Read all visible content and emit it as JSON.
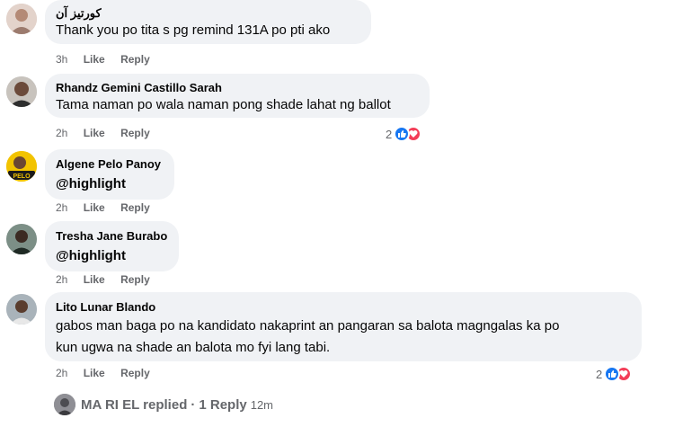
{
  "comments": [
    {
      "author": "كورتيز آن",
      "text": "Thank you po tita s pg remind 131A po pti ako",
      "time": "3h",
      "like": "Like",
      "reply": "Reply"
    },
    {
      "author": "Rhandz Gemini Castillo Sarah",
      "text": "Tama naman po wala naman pong shade lahat ng ballot",
      "time": "2h",
      "like": "Like",
      "reply": "Reply",
      "reactions": {
        "count": "2",
        "icons": [
          "like-icon",
          "love-icon"
        ]
      }
    },
    {
      "author": "Algene Pelo Panoy",
      "text": "@highlight",
      "time": "2h",
      "like": "Like",
      "reply": "Reply",
      "avatar_badge": "PELO"
    },
    {
      "author": "Tresha Jane Burabo",
      "text": "@highlight",
      "time": "2h",
      "like": "Like",
      "reply": "Reply"
    },
    {
      "author": "Lito Lunar Blando",
      "text_lines": [
        "gabos man baga po na kandidato nakaprint an pangaran sa balota magngalas ka po",
        "kun ugwa na shade an balota mo fyi lang tabi."
      ],
      "time": "2h",
      "like": "Like",
      "reply": "Reply",
      "reactions": {
        "count": "2",
        "icons": [
          "like-icon",
          "love-icon"
        ]
      }
    }
  ],
  "replies_summary": {
    "who": "MA RI EL replied",
    "separator": "·",
    "count": "1 Reply",
    "time": "12m"
  },
  "colors": {
    "bubble": "#f0f2f5",
    "meta": "#65676b",
    "like_blue": "#1877f2",
    "love_red": "#f33e58"
  }
}
